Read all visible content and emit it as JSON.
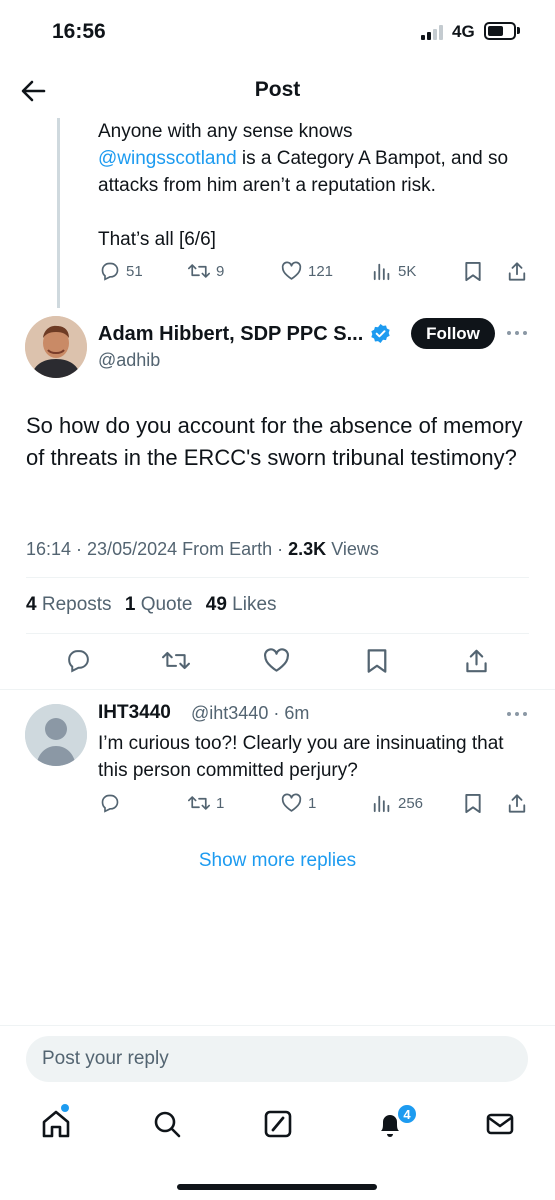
{
  "status_bar": {
    "time": "16:56",
    "network": "4G"
  },
  "header": {
    "title": "Post"
  },
  "previous_tweet": {
    "line1": "Anyone with any sense knows",
    "mention": "@wingsscotland",
    "line2_rest": " is a Category A Bampot, and so attacks from him aren’t a reputation risk.",
    "line3": "That’s all [6/6]",
    "replies": "51",
    "reposts": "9",
    "likes": "121",
    "views": "5K"
  },
  "main_tweet": {
    "author_name": "Adam Hibbert, SDP PPC S...",
    "author_handle": "@adhib",
    "follow_label": "Follow",
    "text": "So how do you account for the absence of memory of threats in the ERCC's sworn tribunal testimony?",
    "meta_prefix": "16:14 · 23/05/2024 From Earth · ",
    "views_count": "2.3K",
    "views_label": " Views",
    "reposts_count": "4",
    "reposts_label": " Reposts",
    "quotes_count": "1",
    "quotes_label": " Quote",
    "likes_count": "49",
    "likes_label": " Likes"
  },
  "reply_tweet": {
    "author_name": "IHT3440",
    "handle_time": "@iht3440 · 6m",
    "text": "I’m curious too?! Clearly you are insinuating that this person committed perjury?",
    "replies": "",
    "reposts": "1",
    "likes": "1",
    "views": "256"
  },
  "show_more_label": "Show more replies",
  "composer": {
    "placeholder": "Post your reply"
  },
  "tabbar": {
    "notifications_badge": "4"
  },
  "colors": {
    "accent": "#1d9bf0",
    "text": "#0f1419",
    "muted": "#536471"
  }
}
